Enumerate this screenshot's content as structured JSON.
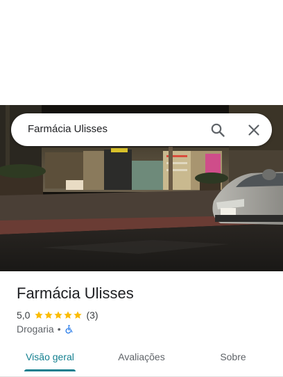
{
  "search": {
    "query": "Farmácia Ulisses"
  },
  "icons": {
    "search": "search-icon",
    "close": "close-icon",
    "star": "star-icon",
    "accessibility": "wheelchair-icon"
  },
  "place": {
    "name": "Farmácia Ulisses",
    "rating_text": "5,0",
    "rating_value": 5.0,
    "rating_max": 5,
    "review_count": "(3)",
    "category": "Drogaria",
    "separator": "•"
  },
  "tabs": [
    {
      "label": "Visão geral",
      "active": true
    },
    {
      "label": "Avaliações",
      "active": false
    },
    {
      "label": "Sobre",
      "active": false
    }
  ],
  "colors": {
    "accent": "#127f8f",
    "star": "#fbbc04",
    "wheelchair": "#1a73e8"
  }
}
